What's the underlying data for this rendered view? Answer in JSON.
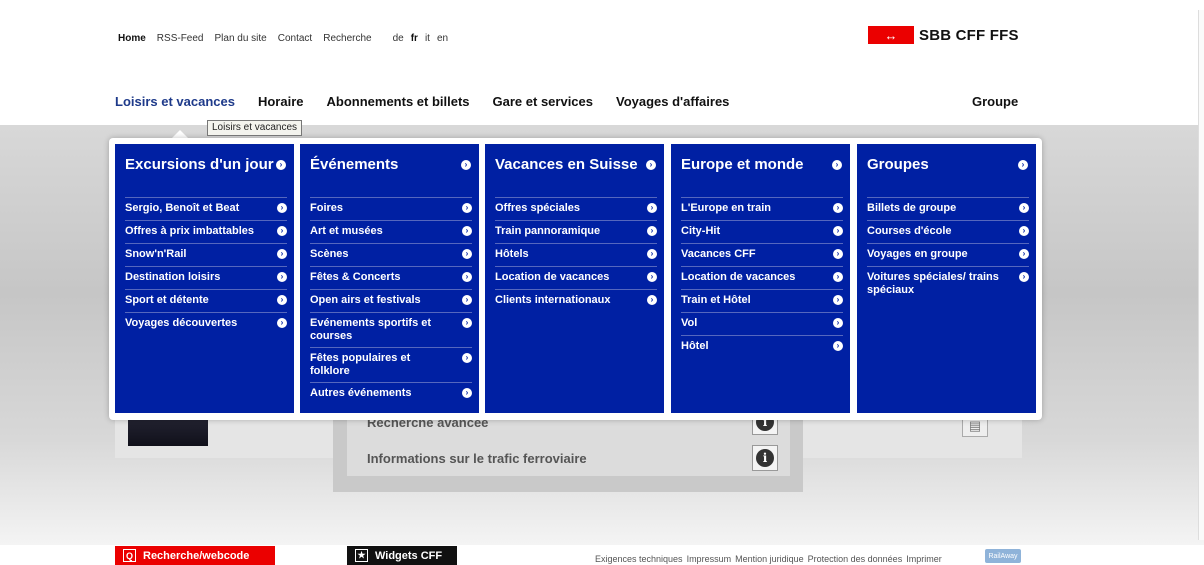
{
  "utility_nav": {
    "items": [
      "Home",
      "RSS-Feed",
      "Plan du site",
      "Contact",
      "Recherche"
    ],
    "languages": [
      "de",
      "fr",
      "it",
      "en"
    ]
  },
  "logo": {
    "symbol": "↔",
    "text": "SBB CFF FFS",
    "brand_color": "#eb0000"
  },
  "main_nav": {
    "items": [
      "Loisirs et vacances",
      "Horaire",
      "Abonnements et billets",
      "Gare et services",
      "Voyages d'affaires"
    ],
    "right": "Groupe",
    "tooltip": "Loisirs et vacances"
  },
  "mega_menu": {
    "accent": "#0020a3",
    "columns": [
      {
        "title": "Excursions d'un jour",
        "items": [
          "Sergio, Benoît et Beat",
          "Offres à prix imbattables",
          "Snow'n'Rail",
          "Destination loisirs",
          "Sport et détente",
          "Voyages découvertes"
        ]
      },
      {
        "title": "Événements",
        "items": [
          "Foires",
          "Art et musées",
          "Scènes",
          "Fêtes & Concerts",
          "Open airs et festivals",
          "Evénements sportifs et courses",
          "Fêtes populaires et folklore",
          "Autres événements"
        ]
      },
      {
        "title": "Vacances en Suisse",
        "items": [
          "Offres spéciales",
          "Train pannoramique",
          "Hôtels",
          "Location de vacances",
          "Clients internationaux"
        ]
      },
      {
        "title": "Europe et monde",
        "items": [
          "L'Europe en train",
          "City-Hit",
          "Vacances CFF",
          "Location de vacances",
          "Train et Hôtel",
          "Vol",
          "Hôtel"
        ]
      },
      {
        "title": "Groupes",
        "items": [
          "Billets de groupe",
          "Courses d'école",
          "Voyages en groupe",
          "Voitures spéciales/ trains spéciaux"
        ]
      }
    ]
  },
  "background": {
    "row_partial": "Recherche avancée",
    "row_traffic": "Informations sur le trafic ferroviaire"
  },
  "footer": {
    "search_button": "Recherche/webcode",
    "widgets_button": "Widgets CFF",
    "links": [
      "Exigences techniques",
      "Impressum",
      "Mention juridique",
      "Protection des données",
      "Imprimer"
    ],
    "partner": "RailAway"
  }
}
